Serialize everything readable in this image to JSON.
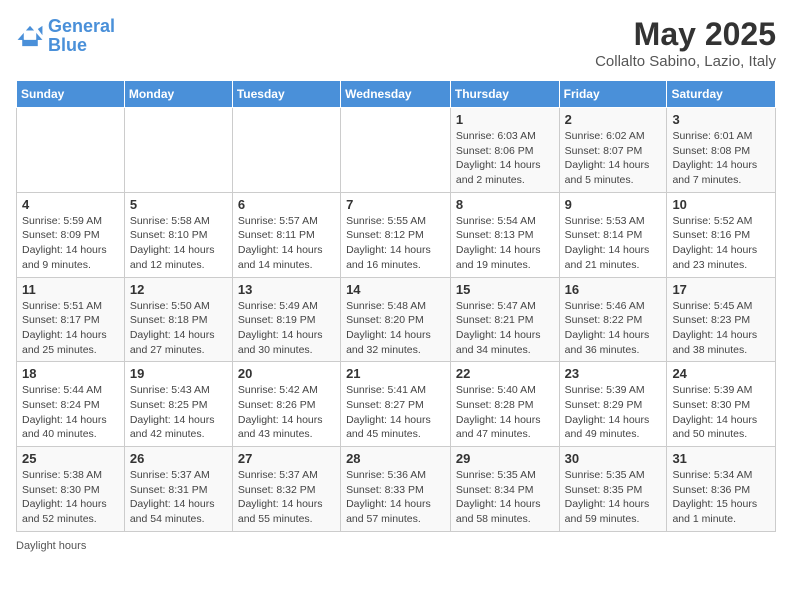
{
  "header": {
    "logo_line1": "General",
    "logo_line2": "Blue",
    "main_title": "May 2025",
    "subtitle": "Collalto Sabino, Lazio, Italy"
  },
  "days_of_week": [
    "Sunday",
    "Monday",
    "Tuesday",
    "Wednesday",
    "Thursday",
    "Friday",
    "Saturday"
  ],
  "weeks": [
    [
      {
        "day": "",
        "info": ""
      },
      {
        "day": "",
        "info": ""
      },
      {
        "day": "",
        "info": ""
      },
      {
        "day": "",
        "info": ""
      },
      {
        "day": "1",
        "info": "Sunrise: 6:03 AM\nSunset: 8:06 PM\nDaylight: 14 hours\nand 2 minutes."
      },
      {
        "day": "2",
        "info": "Sunrise: 6:02 AM\nSunset: 8:07 PM\nDaylight: 14 hours\nand 5 minutes."
      },
      {
        "day": "3",
        "info": "Sunrise: 6:01 AM\nSunset: 8:08 PM\nDaylight: 14 hours\nand 7 minutes."
      }
    ],
    [
      {
        "day": "4",
        "info": "Sunrise: 5:59 AM\nSunset: 8:09 PM\nDaylight: 14 hours\nand 9 minutes."
      },
      {
        "day": "5",
        "info": "Sunrise: 5:58 AM\nSunset: 8:10 PM\nDaylight: 14 hours\nand 12 minutes."
      },
      {
        "day": "6",
        "info": "Sunrise: 5:57 AM\nSunset: 8:11 PM\nDaylight: 14 hours\nand 14 minutes."
      },
      {
        "day": "7",
        "info": "Sunrise: 5:55 AM\nSunset: 8:12 PM\nDaylight: 14 hours\nand 16 minutes."
      },
      {
        "day": "8",
        "info": "Sunrise: 5:54 AM\nSunset: 8:13 PM\nDaylight: 14 hours\nand 19 minutes."
      },
      {
        "day": "9",
        "info": "Sunrise: 5:53 AM\nSunset: 8:14 PM\nDaylight: 14 hours\nand 21 minutes."
      },
      {
        "day": "10",
        "info": "Sunrise: 5:52 AM\nSunset: 8:16 PM\nDaylight: 14 hours\nand 23 minutes."
      }
    ],
    [
      {
        "day": "11",
        "info": "Sunrise: 5:51 AM\nSunset: 8:17 PM\nDaylight: 14 hours\nand 25 minutes."
      },
      {
        "day": "12",
        "info": "Sunrise: 5:50 AM\nSunset: 8:18 PM\nDaylight: 14 hours\nand 27 minutes."
      },
      {
        "day": "13",
        "info": "Sunrise: 5:49 AM\nSunset: 8:19 PM\nDaylight: 14 hours\nand 30 minutes."
      },
      {
        "day": "14",
        "info": "Sunrise: 5:48 AM\nSunset: 8:20 PM\nDaylight: 14 hours\nand 32 minutes."
      },
      {
        "day": "15",
        "info": "Sunrise: 5:47 AM\nSunset: 8:21 PM\nDaylight: 14 hours\nand 34 minutes."
      },
      {
        "day": "16",
        "info": "Sunrise: 5:46 AM\nSunset: 8:22 PM\nDaylight: 14 hours\nand 36 minutes."
      },
      {
        "day": "17",
        "info": "Sunrise: 5:45 AM\nSunset: 8:23 PM\nDaylight: 14 hours\nand 38 minutes."
      }
    ],
    [
      {
        "day": "18",
        "info": "Sunrise: 5:44 AM\nSunset: 8:24 PM\nDaylight: 14 hours\nand 40 minutes."
      },
      {
        "day": "19",
        "info": "Sunrise: 5:43 AM\nSunset: 8:25 PM\nDaylight: 14 hours\nand 42 minutes."
      },
      {
        "day": "20",
        "info": "Sunrise: 5:42 AM\nSunset: 8:26 PM\nDaylight: 14 hours\nand 43 minutes."
      },
      {
        "day": "21",
        "info": "Sunrise: 5:41 AM\nSunset: 8:27 PM\nDaylight: 14 hours\nand 45 minutes."
      },
      {
        "day": "22",
        "info": "Sunrise: 5:40 AM\nSunset: 8:28 PM\nDaylight: 14 hours\nand 47 minutes."
      },
      {
        "day": "23",
        "info": "Sunrise: 5:39 AM\nSunset: 8:29 PM\nDaylight: 14 hours\nand 49 minutes."
      },
      {
        "day": "24",
        "info": "Sunrise: 5:39 AM\nSunset: 8:30 PM\nDaylight: 14 hours\nand 50 minutes."
      }
    ],
    [
      {
        "day": "25",
        "info": "Sunrise: 5:38 AM\nSunset: 8:30 PM\nDaylight: 14 hours\nand 52 minutes."
      },
      {
        "day": "26",
        "info": "Sunrise: 5:37 AM\nSunset: 8:31 PM\nDaylight: 14 hours\nand 54 minutes."
      },
      {
        "day": "27",
        "info": "Sunrise: 5:37 AM\nSunset: 8:32 PM\nDaylight: 14 hours\nand 55 minutes."
      },
      {
        "day": "28",
        "info": "Sunrise: 5:36 AM\nSunset: 8:33 PM\nDaylight: 14 hours\nand 57 minutes."
      },
      {
        "day": "29",
        "info": "Sunrise: 5:35 AM\nSunset: 8:34 PM\nDaylight: 14 hours\nand 58 minutes."
      },
      {
        "day": "30",
        "info": "Sunrise: 5:35 AM\nSunset: 8:35 PM\nDaylight: 14 hours\nand 59 minutes."
      },
      {
        "day": "31",
        "info": "Sunrise: 5:34 AM\nSunset: 8:36 PM\nDaylight: 15 hours\nand 1 minute."
      }
    ]
  ],
  "footer": {
    "daylight_label": "Daylight hours"
  }
}
